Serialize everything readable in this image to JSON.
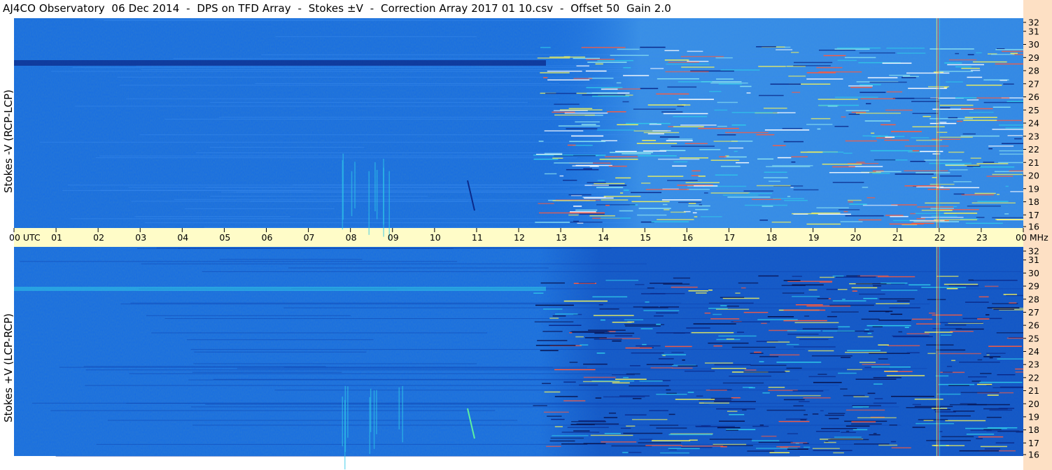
{
  "title": "AJ4CO Observatory  06 Dec 2014  -  DPS on TFD Array  -  Stokes ±V  -  Correction Array 2017 01 10.csv  -  Offset 50  Gain 2.0",
  "colors": {
    "background_blue": "#1a6fe0",
    "deep_blue": "#0b3fb0",
    "cyan": "#2fc8e8",
    "yellow": "#f2f25a",
    "time_bar": "#fffcc8",
    "freq_strip": "#fde0c4"
  },
  "chart_data": [
    {
      "type": "heatmap",
      "panel": "top",
      "ylabel": "Stokes -V (RCP-LCP)",
      "y_unit": "MHz",
      "yticks": [
        32,
        31,
        30,
        29,
        28,
        27,
        26,
        25,
        24,
        23,
        22,
        21,
        20,
        19,
        18,
        17,
        16
      ],
      "ylim": [
        16,
        32
      ],
      "xlim": [
        "00",
        "00"
      ]
    },
    {
      "type": "heatmap",
      "panel": "bottom",
      "ylabel": "Stokes +V (LCP-RCP)",
      "y_unit": "",
      "yticks": [
        32,
        31,
        30,
        29,
        28,
        27,
        26,
        25,
        24,
        23,
        22,
        21,
        20,
        19,
        18,
        17,
        16
      ],
      "ylim": [
        16,
        32
      ],
      "xlim": [
        "00",
        "00"
      ]
    }
  ],
  "time_axis": {
    "labels": [
      "00",
      "01",
      "02",
      "03",
      "04",
      "05",
      "06",
      "07",
      "08",
      "09",
      "10",
      "11",
      "12",
      "13",
      "14",
      "15",
      "16",
      "17",
      "18",
      "19",
      "20",
      "21",
      "22",
      "23",
      "00"
    ],
    "first_suffix": "UTC",
    "last_suffix": "MHz"
  }
}
